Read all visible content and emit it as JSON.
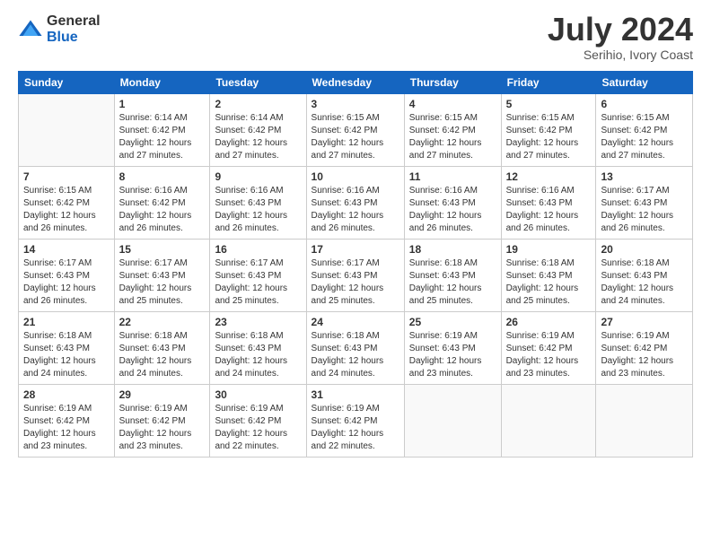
{
  "logo": {
    "general": "General",
    "blue": "Blue"
  },
  "title": "July 2024",
  "location": "Serihio, Ivory Coast",
  "days_header": [
    "Sunday",
    "Monday",
    "Tuesday",
    "Wednesday",
    "Thursday",
    "Friday",
    "Saturday"
  ],
  "weeks": [
    [
      {
        "day": "",
        "info": ""
      },
      {
        "day": "1",
        "info": "Sunrise: 6:14 AM\nSunset: 6:42 PM\nDaylight: 12 hours\nand 27 minutes."
      },
      {
        "day": "2",
        "info": "Sunrise: 6:14 AM\nSunset: 6:42 PM\nDaylight: 12 hours\nand 27 minutes."
      },
      {
        "day": "3",
        "info": "Sunrise: 6:15 AM\nSunset: 6:42 PM\nDaylight: 12 hours\nand 27 minutes."
      },
      {
        "day": "4",
        "info": "Sunrise: 6:15 AM\nSunset: 6:42 PM\nDaylight: 12 hours\nand 27 minutes."
      },
      {
        "day": "5",
        "info": "Sunrise: 6:15 AM\nSunset: 6:42 PM\nDaylight: 12 hours\nand 27 minutes."
      },
      {
        "day": "6",
        "info": "Sunrise: 6:15 AM\nSunset: 6:42 PM\nDaylight: 12 hours\nand 27 minutes."
      }
    ],
    [
      {
        "day": "7",
        "info": "Sunrise: 6:15 AM\nSunset: 6:42 PM\nDaylight: 12 hours\nand 26 minutes."
      },
      {
        "day": "8",
        "info": "Sunrise: 6:16 AM\nSunset: 6:42 PM\nDaylight: 12 hours\nand 26 minutes."
      },
      {
        "day": "9",
        "info": "Sunrise: 6:16 AM\nSunset: 6:43 PM\nDaylight: 12 hours\nand 26 minutes."
      },
      {
        "day": "10",
        "info": "Sunrise: 6:16 AM\nSunset: 6:43 PM\nDaylight: 12 hours\nand 26 minutes."
      },
      {
        "day": "11",
        "info": "Sunrise: 6:16 AM\nSunset: 6:43 PM\nDaylight: 12 hours\nand 26 minutes."
      },
      {
        "day": "12",
        "info": "Sunrise: 6:16 AM\nSunset: 6:43 PM\nDaylight: 12 hours\nand 26 minutes."
      },
      {
        "day": "13",
        "info": "Sunrise: 6:17 AM\nSunset: 6:43 PM\nDaylight: 12 hours\nand 26 minutes."
      }
    ],
    [
      {
        "day": "14",
        "info": "Sunrise: 6:17 AM\nSunset: 6:43 PM\nDaylight: 12 hours\nand 26 minutes."
      },
      {
        "day": "15",
        "info": "Sunrise: 6:17 AM\nSunset: 6:43 PM\nDaylight: 12 hours\nand 25 minutes."
      },
      {
        "day": "16",
        "info": "Sunrise: 6:17 AM\nSunset: 6:43 PM\nDaylight: 12 hours\nand 25 minutes."
      },
      {
        "day": "17",
        "info": "Sunrise: 6:17 AM\nSunset: 6:43 PM\nDaylight: 12 hours\nand 25 minutes."
      },
      {
        "day": "18",
        "info": "Sunrise: 6:18 AM\nSunset: 6:43 PM\nDaylight: 12 hours\nand 25 minutes."
      },
      {
        "day": "19",
        "info": "Sunrise: 6:18 AM\nSunset: 6:43 PM\nDaylight: 12 hours\nand 25 minutes."
      },
      {
        "day": "20",
        "info": "Sunrise: 6:18 AM\nSunset: 6:43 PM\nDaylight: 12 hours\nand 24 minutes."
      }
    ],
    [
      {
        "day": "21",
        "info": "Sunrise: 6:18 AM\nSunset: 6:43 PM\nDaylight: 12 hours\nand 24 minutes."
      },
      {
        "day": "22",
        "info": "Sunrise: 6:18 AM\nSunset: 6:43 PM\nDaylight: 12 hours\nand 24 minutes."
      },
      {
        "day": "23",
        "info": "Sunrise: 6:18 AM\nSunset: 6:43 PM\nDaylight: 12 hours\nand 24 minutes."
      },
      {
        "day": "24",
        "info": "Sunrise: 6:18 AM\nSunset: 6:43 PM\nDaylight: 12 hours\nand 24 minutes."
      },
      {
        "day": "25",
        "info": "Sunrise: 6:19 AM\nSunset: 6:43 PM\nDaylight: 12 hours\nand 23 minutes."
      },
      {
        "day": "26",
        "info": "Sunrise: 6:19 AM\nSunset: 6:42 PM\nDaylight: 12 hours\nand 23 minutes."
      },
      {
        "day": "27",
        "info": "Sunrise: 6:19 AM\nSunset: 6:42 PM\nDaylight: 12 hours\nand 23 minutes."
      }
    ],
    [
      {
        "day": "28",
        "info": "Sunrise: 6:19 AM\nSunset: 6:42 PM\nDaylight: 12 hours\nand 23 minutes."
      },
      {
        "day": "29",
        "info": "Sunrise: 6:19 AM\nSunset: 6:42 PM\nDaylight: 12 hours\nand 23 minutes."
      },
      {
        "day": "30",
        "info": "Sunrise: 6:19 AM\nSunset: 6:42 PM\nDaylight: 12 hours\nand 22 minutes."
      },
      {
        "day": "31",
        "info": "Sunrise: 6:19 AM\nSunset: 6:42 PM\nDaylight: 12 hours\nand 22 minutes."
      },
      {
        "day": "",
        "info": ""
      },
      {
        "day": "",
        "info": ""
      },
      {
        "day": "",
        "info": ""
      }
    ]
  ]
}
